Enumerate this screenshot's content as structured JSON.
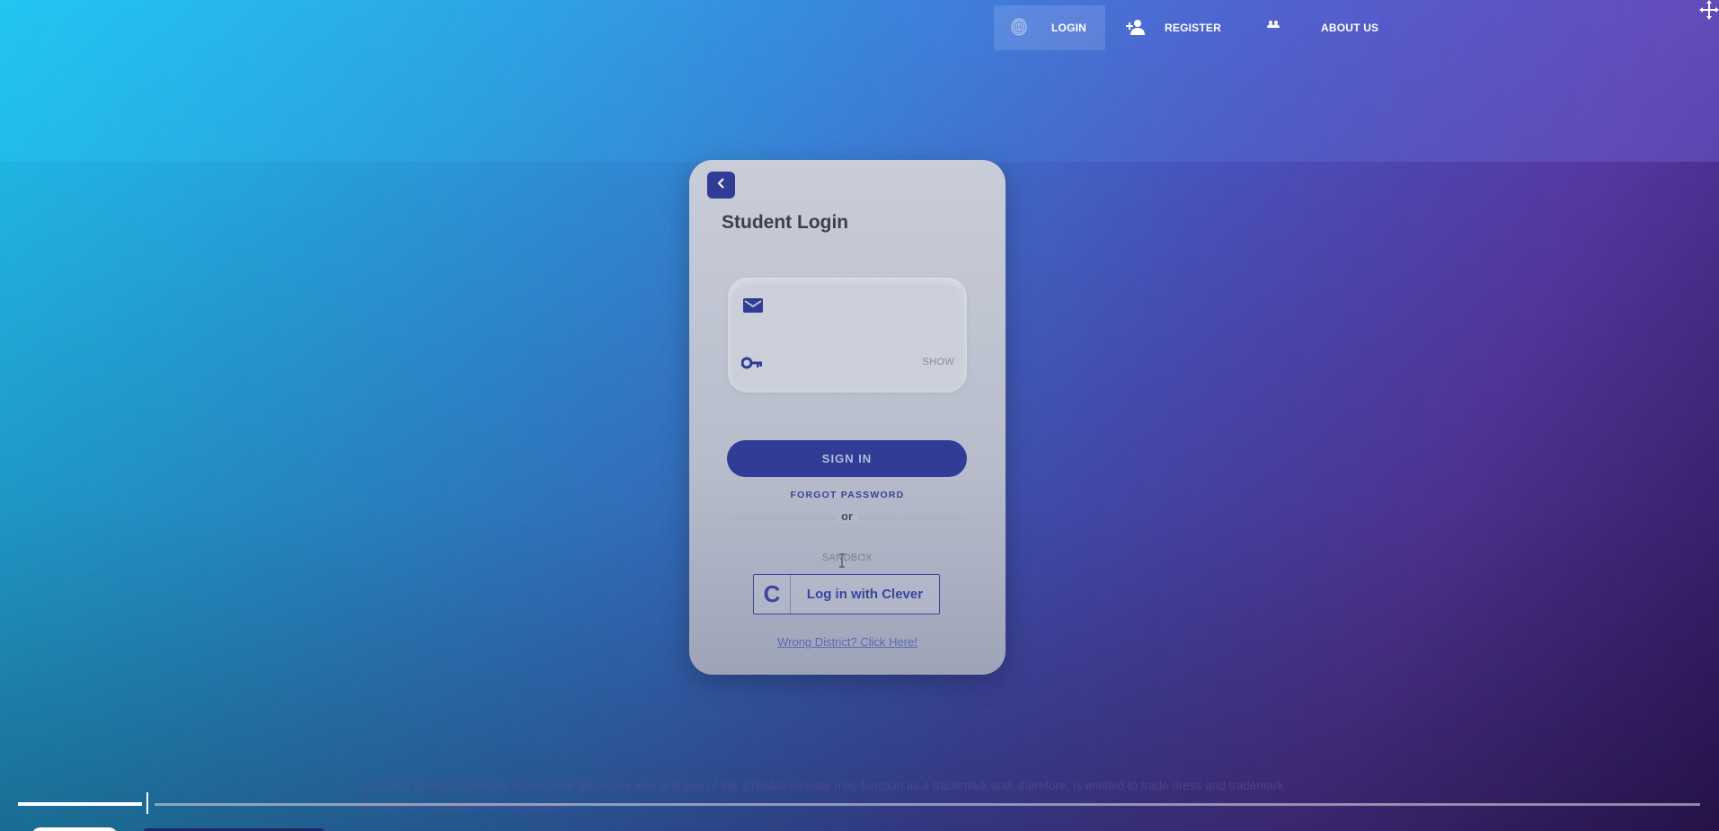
{
  "nav": {
    "items": [
      {
        "label": "LOGIN",
        "icon": "fingerprint-icon",
        "active": true
      },
      {
        "label": "REGISTER",
        "icon": "add-person-icon",
        "active": false
      },
      {
        "label": "ABOUT US",
        "icon": "group-icon",
        "active": false
      }
    ],
    "corner_icon": "move-icon"
  },
  "login_card": {
    "back_icon": "chevron-left-icon",
    "title": "Student Login",
    "email": {
      "icon": "envelope-icon",
      "value": "",
      "placeholder": ""
    },
    "password": {
      "icon": "key-icon",
      "value": "",
      "placeholder": "",
      "show_label": "SHOW"
    },
    "sign_in_label": "SIGN IN",
    "forgot_password_label": "FORGOT PASSWORD",
    "or_label": "or",
    "sandbox_label": "SANDBOX",
    "clever": {
      "logo": "C",
      "label": "Log in with Clever"
    },
    "wrong_district_link": "Wrong District? Click Here!"
  },
  "footer": {
    "text": "© 2020 STEMuli Education. Notice: The distinctive look and feel of the STEMuli website may function as a trademark and, therefore, is entitled to trade dress and trademark recognition, registration and protection."
  },
  "video": {
    "progress": 0.08
  },
  "colors": {
    "primary": "#303c96",
    "card": "#c3c7d3",
    "gradient_start": "#1fc3ef",
    "gradient_end": "#3a1c6e"
  }
}
